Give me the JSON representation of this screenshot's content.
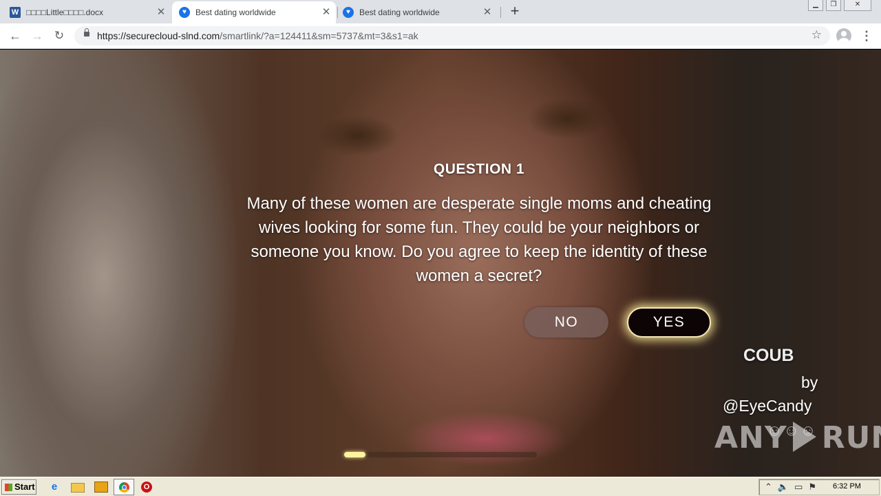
{
  "browser": {
    "tabs": [
      {
        "title": "□□□□Little□□□□.docx",
        "icon": "word-icon",
        "active": false
      },
      {
        "title": "Best dating worldwide",
        "icon": "heart-shield-icon",
        "active": true
      },
      {
        "title": "Best dating worldwide",
        "icon": "heart-shield-icon",
        "active": false
      }
    ],
    "new_tab_label": "+",
    "url": {
      "host": "https://securecloud-slnd.com",
      "path": "/smartlink/?a=124411&sm=5737&mt=3&s1=ak"
    },
    "window_controls": {
      "minimize": "▁",
      "maximize": "❐",
      "close": "✕"
    }
  },
  "quiz": {
    "title": "QUESTION 1",
    "question": "Many of these women are desperate single moms and cheating wives looking for some fun. They could be your neighbors or someone you know. Do you agree to keep the identity of these women a secret?",
    "no_label": "NO",
    "yes_label": "YES",
    "progress_fraction": 0.11
  },
  "credit": {
    "brand": "COUB",
    "by": "by",
    "handle": "@EyeCandy"
  },
  "watermark": {
    "left": "ANY",
    "right": "RUN",
    "faces": "☺☺☺"
  },
  "taskbar": {
    "start_label": "Start",
    "clock": "6:32 PM",
    "tray_icons": "⌃🔈▭⚑"
  },
  "colors": {
    "yes_glow": "#fdf3a0",
    "yes_bg": "#0d0505",
    "no_bg": "#7a5f5a",
    "tab_strip": "#dee1e6"
  }
}
